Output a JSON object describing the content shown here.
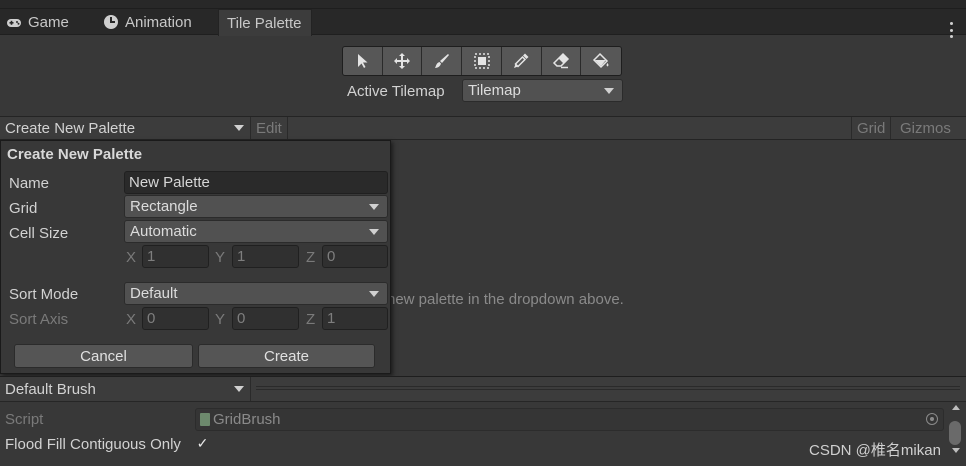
{
  "tabs": [
    {
      "label": "Game",
      "icon": "gamepad-icon"
    },
    {
      "label": "Animation",
      "icon": "clock-icon"
    },
    {
      "label": "Tile Palette",
      "icon": ""
    }
  ],
  "toolbar": {
    "tools": [
      "select-tool-icon",
      "move-tool-icon",
      "paint-brush-icon",
      "box-fill-icon",
      "picker-icon",
      "eraser-icon",
      "fill-bucket-icon"
    ]
  },
  "active_tilemap": {
    "label": "Active Tilemap",
    "value": "Tilemap"
  },
  "palette_bar": {
    "dropdown": "Create New Palette",
    "edit": "Edit",
    "grid": "Grid",
    "gizmos": "Gizmos"
  },
  "hint_text": "new palette in the dropdown above.",
  "popup": {
    "title": "Create New Palette",
    "name_label": "Name",
    "name_value": "New Palette",
    "grid_label": "Grid",
    "grid_value": "Rectangle",
    "cell_size_label": "Cell Size",
    "cell_size_value": "Automatic",
    "cell_x_label": "X",
    "cell_x": "1",
    "cell_y_label": "Y",
    "cell_y": "1",
    "cell_z_label": "Z",
    "cell_z": "0",
    "sort_mode_label": "Sort Mode",
    "sort_mode_value": "Default",
    "sort_axis_label": "Sort Axis",
    "axis_x_label": "X",
    "axis_x": "0",
    "axis_y_label": "Y",
    "axis_y": "0",
    "axis_z_label": "Z",
    "axis_z": "1",
    "cancel": "Cancel",
    "create": "Create"
  },
  "brush": {
    "dropdown": "Default Brush",
    "script_label": "Script",
    "script_value": "GridBrush",
    "flood_label": "Flood Fill Contiguous Only",
    "flood_checked": "✓"
  },
  "watermark": "CSDN @椎名mikan"
}
